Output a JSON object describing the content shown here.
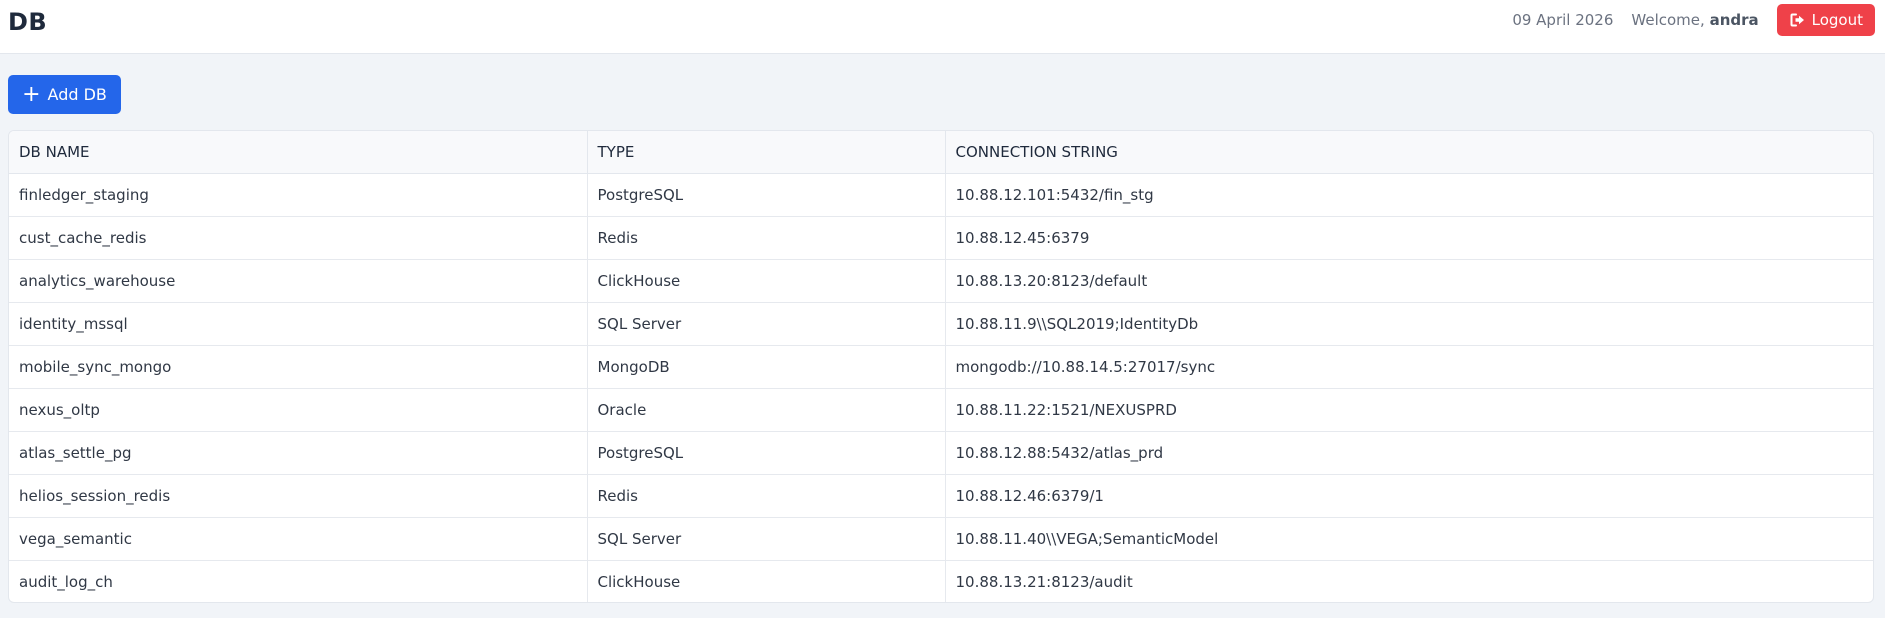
{
  "header": {
    "title": "DB",
    "date": "09 April 2026",
    "welcome_prefix": "Welcome,",
    "username": "andra",
    "logout_label": "Logout"
  },
  "toolbar": {
    "add_label": "Add DB"
  },
  "table": {
    "columns": [
      "DB NAME",
      "TYPE",
      "CONNECTION STRING"
    ],
    "rows": [
      [
        "finledger_staging",
        "PostgreSQL",
        "10.88.12.101:5432/fin_stg"
      ],
      [
        "cust_cache_redis",
        "Redis",
        "10.88.12.45:6379"
      ],
      [
        "analytics_warehouse",
        "ClickHouse",
        "10.88.13.20:8123/default"
      ],
      [
        "identity_mssql",
        "SQL Server",
        "10.88.11.9\\\\SQL2019;IdentityDb"
      ],
      [
        "mobile_sync_mongo",
        "MongoDB",
        "mongodb://10.88.14.5:27017/sync"
      ],
      [
        "nexus_oltp",
        "Oracle",
        "10.88.11.22:1521/NEXUSPRD"
      ],
      [
        "atlas_settle_pg",
        "PostgreSQL",
        "10.88.12.88:5432/atlas_prd"
      ],
      [
        "helios_session_redis",
        "Redis",
        "10.88.12.46:6379/1"
      ],
      [
        "vega_semantic",
        "SQL Server",
        "10.88.11.40\\\\VEGA;SemanticModel"
      ],
      [
        "audit_log_ch",
        "ClickHouse",
        "10.88.13.21:8123/audit"
      ]
    ]
  },
  "colors": {
    "primary": "#2466ea",
    "danger": "#ef4149",
    "background": "#f1f4f8"
  },
  "icons": {
    "logout": "sign-out-icon",
    "add": "plus-icon"
  }
}
